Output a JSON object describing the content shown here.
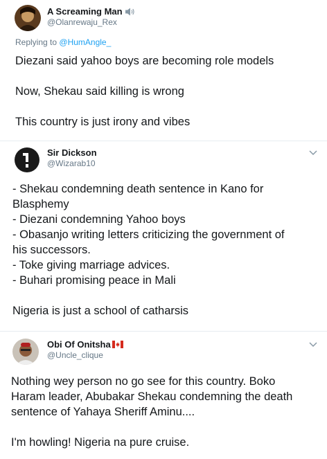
{
  "tweets": [
    {
      "display_name": "A Screaming Man",
      "handle": "@Olanrewaju_Rex",
      "badge_icon": "speaker-icon",
      "reply_prefix": "Replying to",
      "reply_mention": "@HumAngle_",
      "lines": [
        "Diezani said yahoo boys are becoming role models",
        "",
        "Now, Shekau said killing is wrong",
        "",
        "This country is just irony and vibes"
      ]
    },
    {
      "display_name": "Sir Dickson",
      "handle": "@Wizarab10",
      "lines": [
        "- Shekau condemning death sentence in Kano for",
        "Blasphemy",
        "- Diezani condemning Yahoo boys",
        "- Obasanjo writing letters criticizing the government of",
        "his successors.",
        "- Toke giving marriage advices.",
        "- Buhari promising peace in Mali",
        "",
        "Nigeria is just a school of catharsis"
      ]
    },
    {
      "display_name": "Obi Of Onitsha",
      "handle": "@Uncle_clique",
      "badge_icon": "canada-flag-icon",
      "lines": [
        "Nothing wey person no go see for this country. Boko",
        "Haram leader, Abubakar Shekau condemning the death",
        "sentence of Yahaya Sheriff Aminu....",
        "",
        "I'm howling! Nigeria na pure cruise."
      ]
    }
  ],
  "colors": {
    "primary_text": "#14171a",
    "secondary_text": "#657786",
    "link": "#1da1f2",
    "divider": "#e6ecf0"
  }
}
